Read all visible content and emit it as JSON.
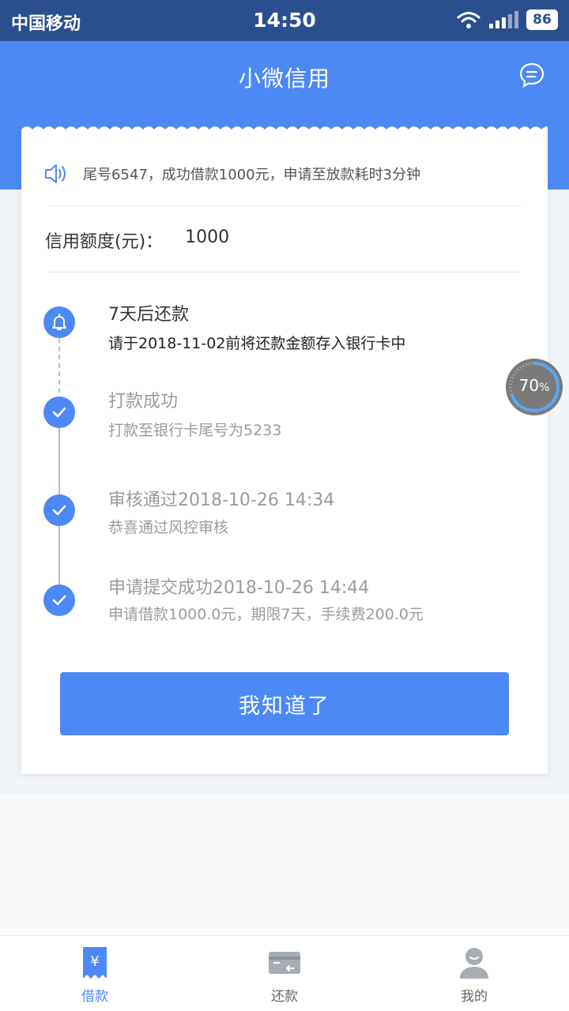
{
  "status_bar": {
    "carrier": "中国移动",
    "time": "14:50",
    "battery": "86"
  },
  "header": {
    "title": "小微信用"
  },
  "notice": {
    "text": "尾号6547，成功借款1000元，申请至放款耗时3分钟"
  },
  "credit": {
    "label": "信用额度(元)：",
    "value": "1000"
  },
  "timeline": [
    {
      "title": "7天后还款",
      "sub": "请于2018-11-02前将还款金额存入银行卡中",
      "icon": "bell-icon"
    },
    {
      "title": "打款成功",
      "sub": "打款至银行卡尾号为5233",
      "icon": "check-icon"
    },
    {
      "title": "审核通过2018-10-26 14:34",
      "sub": "恭喜通过风控审核",
      "icon": "check-icon"
    },
    {
      "title": "申请提交成功2018-10-26 14:44",
      "sub": "申请借款1000.0元，期限7天，手续费200.0元",
      "icon": "check-icon"
    }
  ],
  "button": {
    "label": "我知道了"
  },
  "progress": {
    "value": "70",
    "unit": "%"
  },
  "tabs": [
    {
      "label": "借款",
      "icon": "loan-icon",
      "active": true
    },
    {
      "label": "还款",
      "icon": "card-icon",
      "active": false
    },
    {
      "label": "我的",
      "icon": "user-icon",
      "active": false
    }
  ],
  "colors": {
    "primary": "#4d89f5",
    "status_bar": "#2b4e8f"
  }
}
